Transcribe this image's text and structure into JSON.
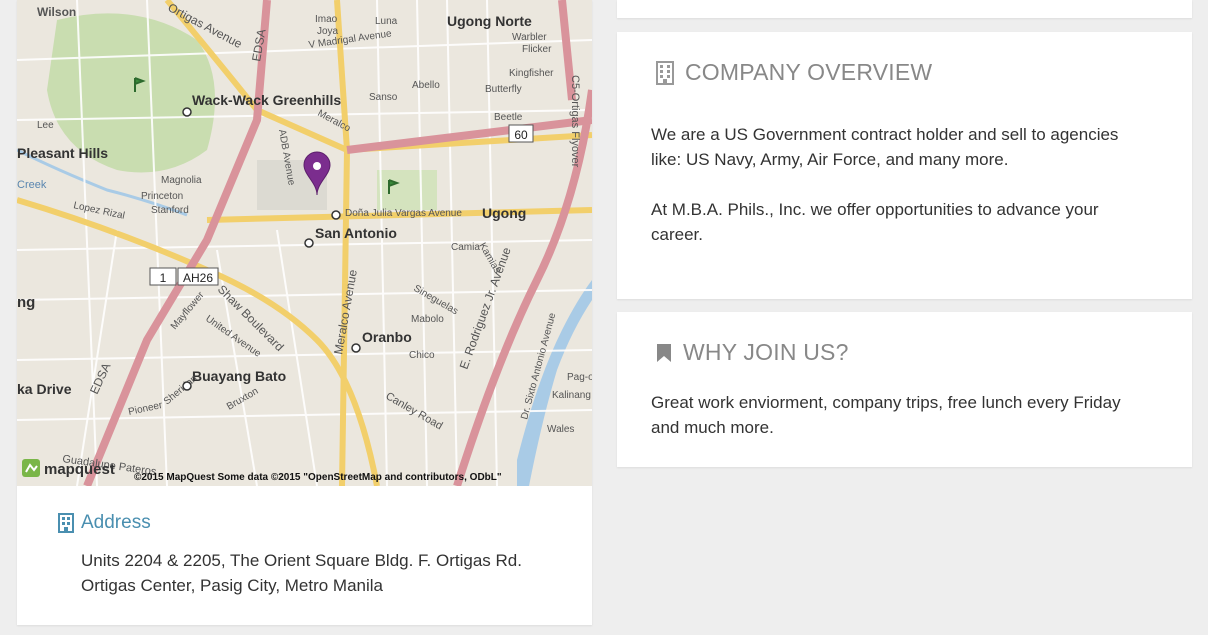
{
  "map": {
    "provider_logo": "mapquest",
    "attribution": "©2015 MapQuest Some data ©2015 \"OpenStreetMap and contributors, ODbL\"",
    "marker_icon": "map-pin-icon",
    "labels": {
      "wilson": "Wilson",
      "ortigas_avenue_top": "Ortigas Avenue",
      "edsa_top": "EDSA",
      "imao": "Imao",
      "joya": "Joya",
      "v_madrigal": "V Madrigal Avenue",
      "luna": "Luna",
      "ugong_norte": "Ugong Norte",
      "warbler": "Warbler",
      "flicker": "Flicker",
      "kingfisher": "Kingfisher",
      "c5_ortigas": "C5-Ortigas Flyover",
      "wack_wack": "Wack-Wack Greenhills",
      "sanso": "Sanso",
      "abello": "Abello",
      "butterfly": "Butterfly",
      "beetle": "Beetle",
      "shield_60": "60",
      "lee": "Lee",
      "meralco_top": "Meralco",
      "pleasant_hills": "Pleasant Hills",
      "adb_avenue": "ADB Avenue",
      "creek": "Creek",
      "magnolia": "Magnolia",
      "princeton": "Princeton",
      "stanford": "Stanford",
      "lopez_rizal": "Lopez Rizal",
      "dona_julia": "Doña Julia Vargas Avenue",
      "ugong": "Ugong",
      "san_antonio": "San Antonio",
      "camia": "Camia",
      "kamias": "Kamias",
      "shield_1": "1",
      "shield_ah26": "AH26",
      "ng": "ng",
      "shaw_boulevard": "Shaw Boulevard",
      "meralco_avenue": "Meralco Avenue",
      "oranbo": "Oranbo",
      "sinegue": "Sineguelas",
      "mabolo": "Mabolo",
      "chico": "Chico",
      "e_rodriguez": "E. Rodriguez Jr. Avenue",
      "edsa_bottom": "EDSA",
      "buayang_bato": "Buayang Bato",
      "ka_drive": "ka Drive",
      "pioneer": "Pioneer",
      "sheridan": "Sheridan",
      "bruxton": "Bruxton",
      "canley_road": "Canley Road",
      "dr_sixto": "Dr. Sixto Antonio Avenue",
      "guadalupe": "Guadalupe Pateros",
      "mayflower": "Mayflower",
      "united_avenue": "United Avenue",
      "pag_o": "Pag-o",
      "kalinang": "Kalinang",
      "wales": "Wales"
    }
  },
  "address": {
    "icon": "building-icon",
    "heading": "Address",
    "line1": "Units 2204 & 2205, The Orient Square Bldg. F. Ortigas Rd.",
    "line2": "Ortigas Center, Pasig City, Metro Manila"
  },
  "overview": {
    "icon": "building-icon",
    "heading": "COMPANY OVERVIEW",
    "para1": "We are a US Government contract holder and sell to agencies like: US Navy, Army, Air Force, and many more.",
    "para2": "At M.B.A. Phils., Inc. we offer opportunities to advance your career."
  },
  "why": {
    "icon": "bookmark-icon",
    "heading": "WHY JOIN US?",
    "body": "Great work enviorment, company trips, free lunch every Friday and much more."
  },
  "colors": {
    "accent": "#4a8fb0",
    "heading_gray": "#888888",
    "marker": "#7b2d8e",
    "major_road": "#d9939b",
    "secondary_road": "#f2cf6b",
    "park": "#c9ddb0"
  }
}
